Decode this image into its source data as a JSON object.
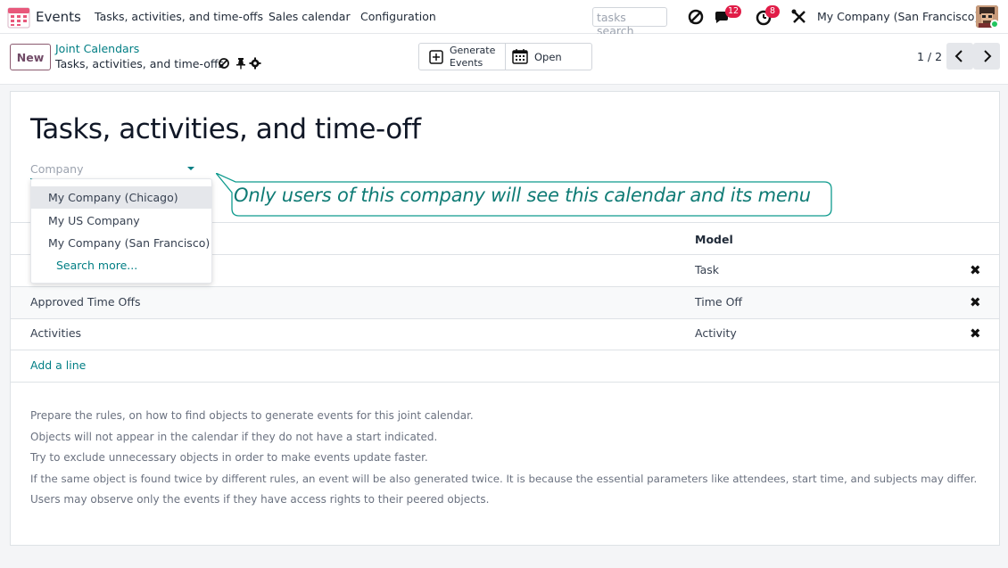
{
  "navbar": {
    "app_name": "Events",
    "menu": [
      "Tasks, activities, and time-offs",
      "Sales calendar",
      "Configuration"
    ],
    "search_placeholder": "tasks search",
    "messages_count": "12",
    "activities_count": "8",
    "company": "My Company (San Francisco)"
  },
  "control": {
    "new_label": "New",
    "breadcrumb_parent": "Joint Calendars",
    "breadcrumb_current": "Tasks, activities, and time-offs",
    "generate_label_1": "Generate",
    "generate_label_2": "Events",
    "open_label": "Open",
    "pager": "1 / 2"
  },
  "form": {
    "title": "Tasks, activities, and time-off",
    "company_placeholder": "Company",
    "model_header": "Model",
    "rows": [
      {
        "name": "",
        "model": "Task"
      },
      {
        "name": "Approved Time Offs",
        "model": "Time Off"
      },
      {
        "name": "Activities",
        "model": "Activity"
      }
    ],
    "delete_glyph": "✖",
    "add_line": "Add a line",
    "help": [
      "Prepare the rules, on how to find objects to generate events for this joint calendar.",
      "Objects will not appear in the calendar if they do not have a start indicated.",
      "Try to exclude unnecessary objects in order to make events update faster.",
      "If the same object is found twice by different rules, an event will be also generated twice. It is because the essential parameters like attendees, start time, and subjects may differ.",
      "Users may observe only the events if they have access rights to their peered objects."
    ]
  },
  "dropdown": {
    "items": [
      "My Company (Chicago)",
      "My US Company",
      "My Company (San Francisco)"
    ],
    "search_more": "Search more..."
  },
  "callout": {
    "text": "Only users of this company will see this calendar and its menu"
  },
  "colors": {
    "accent": "#017e84",
    "brand": "#714b67",
    "callout_text": "#0f7b75"
  }
}
